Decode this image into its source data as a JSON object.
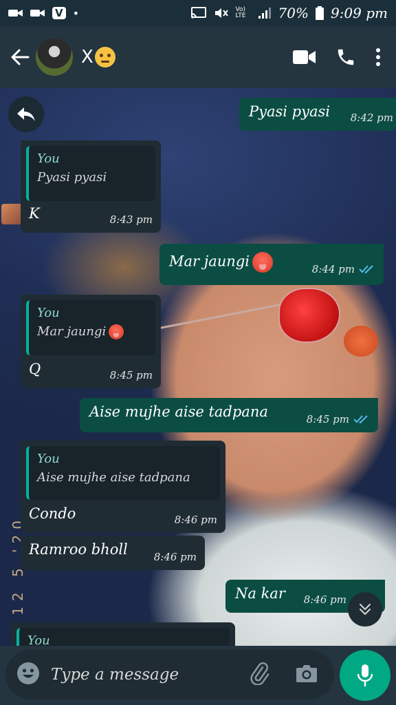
{
  "status_bar": {
    "battery": "70%",
    "time": "9:09 pm",
    "volte": "Vo) LTE",
    "notif_letter": "V",
    "dot": "•"
  },
  "header": {
    "contact_name": "X"
  },
  "messages": [
    {
      "dir": "out",
      "text": "Pyasi pyasi",
      "time": "8:42 pm"
    },
    {
      "dir": "in",
      "quote_author": "You",
      "quote_text": "Pyasi pyasi",
      "text": "K",
      "time": "8:43 pm"
    },
    {
      "dir": "out",
      "text": "Mar jaungi",
      "time": "8:44 pm"
    },
    {
      "dir": "in",
      "quote_author": "You",
      "quote_text": "Mar jaungi",
      "text": "Q",
      "time": "8:45 pm"
    },
    {
      "dir": "out",
      "text": "Aise mujhe aise tadpana",
      "time": "8:45 pm"
    },
    {
      "dir": "in",
      "quote_author": "You",
      "quote_text": "Aise mujhe aise tadpana",
      "text": "Condo",
      "time": "8:46 pm"
    },
    {
      "dir": "in",
      "text": "Ramroo bholl",
      "time": "8:46 pm"
    },
    {
      "dir": "out",
      "text": "Na kar",
      "time": "8:46 pm"
    },
    {
      "dir": "in",
      "quote_author": "You"
    }
  ],
  "side_date": "12 5 '20",
  "composer": {
    "placeholder": "Type a message"
  },
  "colors": {
    "outgoing_bubble": "#0b4d43",
    "incoming_bubble": "#1f2c33",
    "accent": "#00a884",
    "read_ticks": "#53bdeb"
  },
  "icons": [
    "back-arrow-icon",
    "video-call-icon",
    "phone-icon",
    "more-vert-icon",
    "reply-icon",
    "chevrons-down-icon",
    "emoji-icon",
    "attach-icon",
    "camera-icon",
    "mic-icon"
  ]
}
